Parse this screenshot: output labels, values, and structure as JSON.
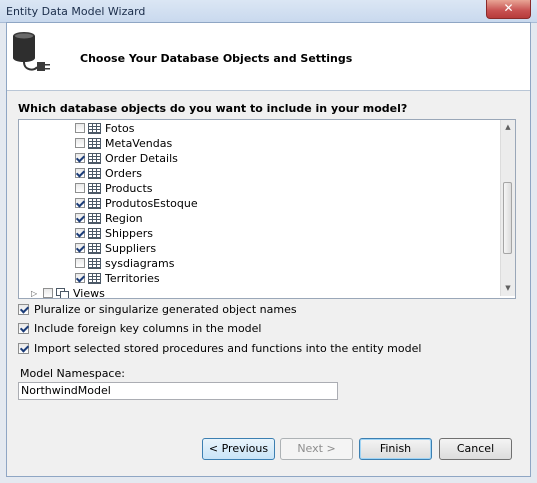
{
  "window": {
    "title": "Entity Data Model Wizard",
    "close_glyph": "✕"
  },
  "header": {
    "title": "Choose Your Database Objects and Settings",
    "icon": "database-plug-icon"
  },
  "question": "Which database objects do you want to include in your model?",
  "tree": {
    "items": [
      {
        "label": "Fotos",
        "checked": false
      },
      {
        "label": "MetaVendas",
        "checked": false
      },
      {
        "label": "Order Details",
        "checked": true
      },
      {
        "label": "Orders",
        "checked": true
      },
      {
        "label": "Products",
        "checked": false
      },
      {
        "label": "ProdutosEstoque",
        "checked": true
      },
      {
        "label": "Region",
        "checked": true
      },
      {
        "label": "Shippers",
        "checked": true
      },
      {
        "label": "Suppliers",
        "checked": true
      },
      {
        "label": "sysdiagrams",
        "checked": false
      },
      {
        "label": "Territories",
        "checked": true
      }
    ],
    "views_node": {
      "label": "Views",
      "checked": false
    }
  },
  "options": [
    {
      "label": "Pluralize or singularize generated object names",
      "checked": true
    },
    {
      "label": "Include foreign key columns in the model",
      "checked": true
    },
    {
      "label": "Import selected stored procedures and functions into the entity model",
      "checked": true
    }
  ],
  "namespace": {
    "label": "Model Namespace:",
    "value": "NorthwindModel"
  },
  "buttons": {
    "previous": "< Previous",
    "next": "Next >",
    "finish": "Finish",
    "cancel": "Cancel"
  }
}
